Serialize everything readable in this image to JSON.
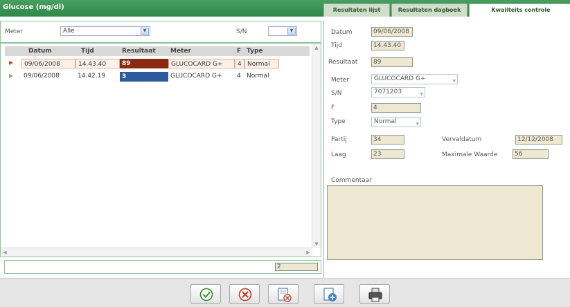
{
  "header": {
    "title": "Glucose (mg/dl)"
  },
  "tabs": [
    {
      "label": "Resultaten lijst",
      "active": false
    },
    {
      "label": "Resultaten dagboek",
      "active": false
    },
    {
      "label": "Kwaliteits controle",
      "active": true
    }
  ],
  "filter": {
    "meter_label": "Meter",
    "meter_value": "Alle",
    "sn_label": "S/N",
    "sn_value": ""
  },
  "grid": {
    "columns": [
      "Datum",
      "Tijd",
      "Resultaat",
      "Meter",
      "F",
      "Type"
    ],
    "rows": [
      {
        "datum": "09/06/2008",
        "tijd": "14.43.40",
        "resultaat": "89",
        "meter": "GLUCOCARD G+",
        "f": "4",
        "type": "Normal",
        "selected": true,
        "result_color": "#8b2a12"
      },
      {
        "datum": "09/06/2008",
        "tijd": "14.42.19",
        "resultaat": "3",
        "meter": "GLUCOCARD G+",
        "f": "4",
        "type": "Normal",
        "selected": false,
        "result_color": "#2c5b9e"
      }
    ],
    "count": "2"
  },
  "detail": {
    "datum_label": "Datum",
    "datum_value": "09/06/2008",
    "tijd_label": "Tijd",
    "tijd_value": "14.43.40",
    "resultaat_label": "Resultaat",
    "resultaat_value": "89",
    "meter_label": "Meter",
    "meter_value": "GLUCOCARD G+",
    "sn_label": "S/N",
    "sn_value": "7071203",
    "f_label": "F",
    "f_value": "4",
    "type_label": "Type",
    "type_value": "Normal",
    "partij_label": "Partij",
    "partij_value": "34",
    "laag_label": "Laag",
    "laag_value": "23",
    "vervaldatum_label": "Vervaldatum",
    "vervaldatum_value": "12/12/2008",
    "maximale_label": "Maximale Waarde",
    "maximale_value": "56",
    "commentaar_label": "Commentaar",
    "commentaar_value": ""
  },
  "toolbar": {
    "buttons": [
      "ok-icon",
      "cancel-icon",
      "delete-doc-icon",
      "new-doc-icon",
      "print-icon"
    ]
  },
  "colors": {
    "accent": "#3a9a52",
    "selected_row": "#fdf2ea"
  }
}
